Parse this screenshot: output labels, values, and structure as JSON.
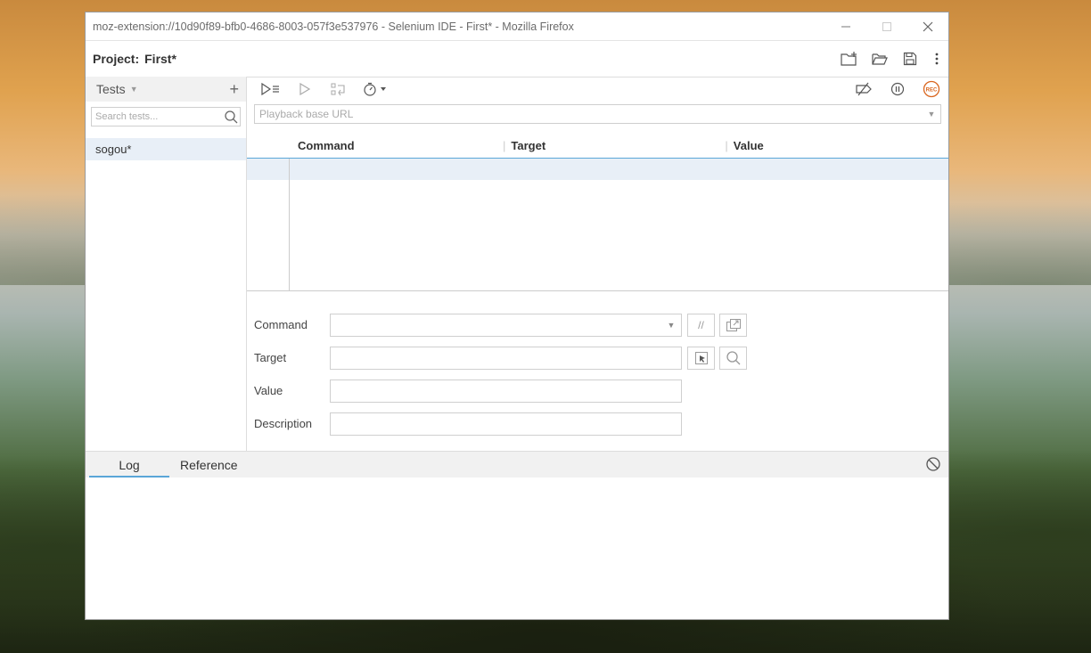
{
  "window": {
    "title": "moz-extension://10d90f89-bfb0-4686-8003-057f3e537976 - Selenium IDE - First* - Mozilla Firefox"
  },
  "project": {
    "label": "Project:",
    "name": "First*"
  },
  "sidebar": {
    "header": "Tests",
    "search_placeholder": "Search tests...",
    "tests": [
      {
        "name": "sogou*"
      }
    ]
  },
  "editor": {
    "url_placeholder": "Playback base URL",
    "columns": [
      "Command",
      "Target",
      "Value"
    ],
    "form": {
      "command_label": "Command",
      "target_label": "Target",
      "value_label": "Value",
      "description_label": "Description",
      "comment_button": "//"
    }
  },
  "console": {
    "tabs": [
      "Log",
      "Reference"
    ]
  },
  "colors": {
    "accent": "#5aa6d8",
    "record": "#d9661f",
    "selected_row": "#e8eff7"
  }
}
